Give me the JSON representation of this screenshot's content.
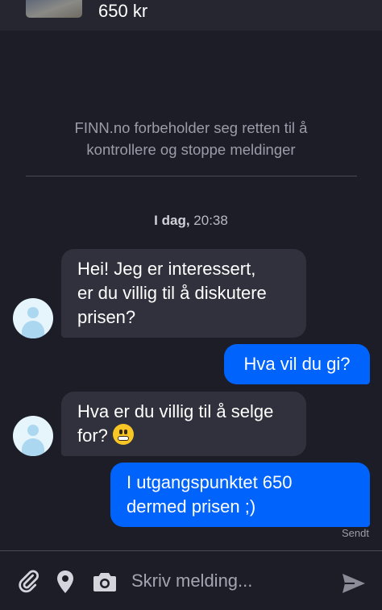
{
  "listing": {
    "price": "650 kr"
  },
  "notice": "FINN.no forbeholder seg retten til å\nkontrollere og stoppe meldinger",
  "timestamp": {
    "day": "I dag,",
    "time": "20:38"
  },
  "messages": [
    {
      "direction": "incoming",
      "text": "Hei! Jeg er interessert,\ner du villig til å diskutere\nprisen?"
    },
    {
      "direction": "outgoing",
      "text": "Hva vil du gi?"
    },
    {
      "direction": "incoming",
      "text": "Hva er du villig til å selge\nfor?",
      "emoji": "grimacing-face"
    },
    {
      "direction": "outgoing",
      "text": "I utgangspunktet 650\ndermed prisen ;)",
      "status": "Sendt"
    }
  ],
  "composer": {
    "placeholder": "Skriv melding...",
    "icons": [
      "paperclip-icon",
      "location-pin-icon",
      "camera-icon",
      "send-icon"
    ]
  },
  "colors": {
    "background": "#1c1d27",
    "incoming_bubble": "#30313c",
    "outgoing_bubble": "#0063fb",
    "muted_text": "#9b9ca7"
  }
}
